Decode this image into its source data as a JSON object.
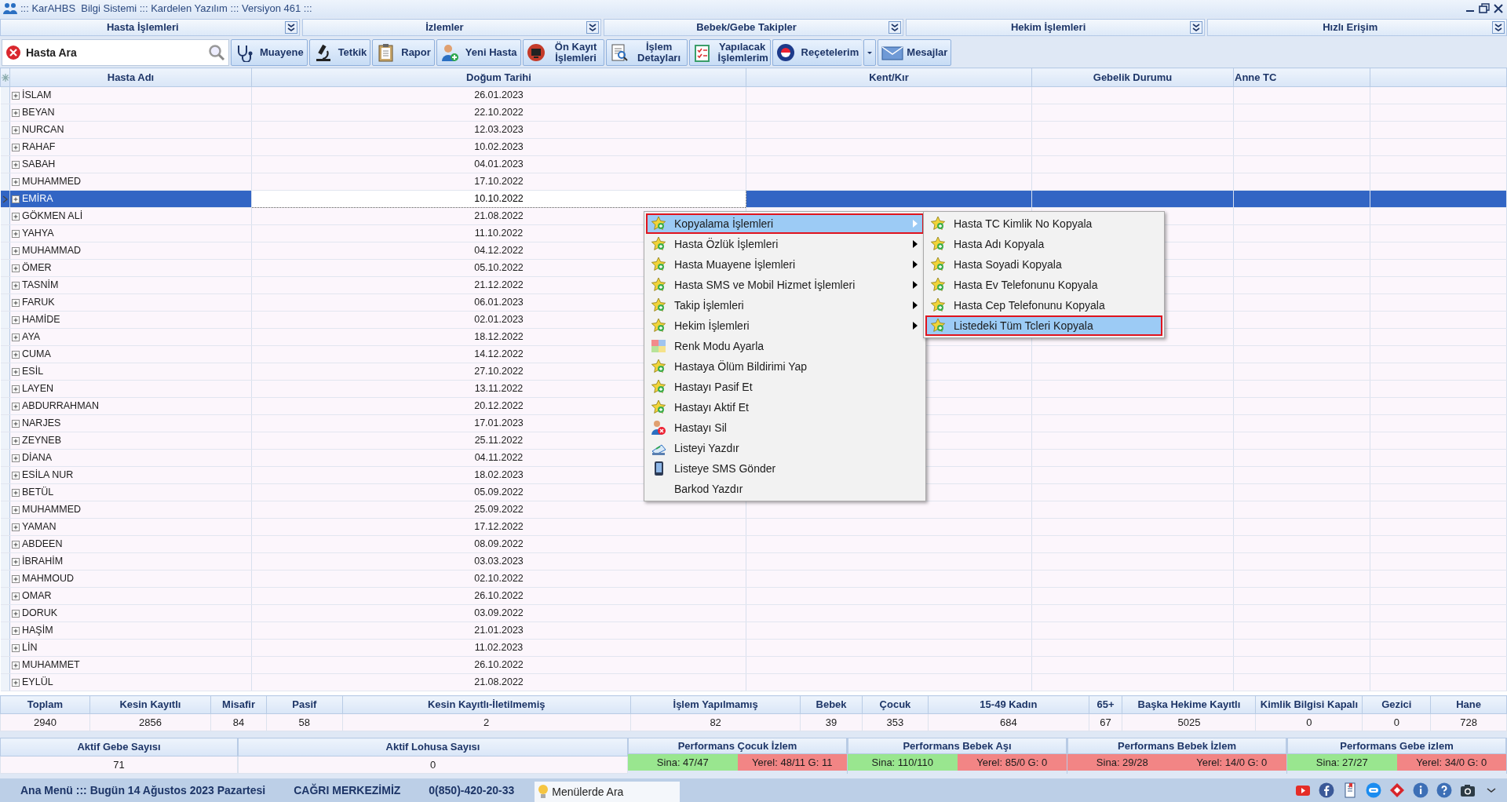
{
  "window": {
    "title": "::: KarAHBS  Bilgi Sistemi ::: Kardelen Yazılım ::: Versiyon 461 :::"
  },
  "sections": [
    {
      "label": "Hasta İşlemleri"
    },
    {
      "label": "İzlemler"
    },
    {
      "label": "Bebek/Gebe Takipler"
    },
    {
      "label": "Hekim İşlemleri"
    },
    {
      "label": "Hızlı Erişim"
    }
  ],
  "search": {
    "placeholder": "Hasta Ara"
  },
  "toolbar": [
    {
      "label": "Muayene",
      "kind": "stethoscope"
    },
    {
      "label": "Tetkik",
      "kind": "microscope"
    },
    {
      "label": "Rapor",
      "kind": "clipboard"
    },
    {
      "label": "Yeni Hasta",
      "kind": "user"
    },
    {
      "label": "Ön Kayıt İşlemleri",
      "kind": "monitor"
    },
    {
      "label": "İşlem Detayları",
      "kind": "document"
    },
    {
      "label": "Yapılacak İşlemlerim",
      "kind": "checklist"
    },
    {
      "label": "Reçetelerim",
      "kind": "capsule",
      "dropdown": true
    },
    {
      "label": "Mesajlar",
      "kind": "envelope"
    }
  ],
  "grid": {
    "columns": [
      "Hasta Adı",
      "Doğum Tarihi",
      "Kent/Kır",
      "Gebelik Durumu",
      "Anne TC"
    ],
    "rows": [
      {
        "name": "İSLAM",
        "date": "26.01.2023",
        "selected": false
      },
      {
        "name": "BEYAN",
        "date": "22.10.2022",
        "selected": false
      },
      {
        "name": "NURCAN",
        "date": "12.03.2023",
        "selected": false
      },
      {
        "name": "RAHAF",
        "date": "10.02.2023",
        "selected": false
      },
      {
        "name": "SABAH",
        "date": "04.01.2023",
        "selected": false
      },
      {
        "name": "MUHAMMED",
        "date": "17.10.2022",
        "selected": false
      },
      {
        "name": "EMİRA",
        "date": "10.10.2022",
        "selected": true
      },
      {
        "name": "GÖKMEN ALİ",
        "date": "21.08.2022",
        "selected": false
      },
      {
        "name": "YAHYA",
        "date": "11.10.2022",
        "selected": false
      },
      {
        "name": "MUHAMMAD",
        "date": "04.12.2022",
        "selected": false
      },
      {
        "name": "ÖMER",
        "date": "05.10.2022",
        "selected": false
      },
      {
        "name": "TASNİM",
        "date": "21.12.2022",
        "selected": false
      },
      {
        "name": "FARUK",
        "date": "06.01.2023",
        "selected": false
      },
      {
        "name": "HAMİDE",
        "date": "02.01.2023",
        "selected": false
      },
      {
        "name": "AYA",
        "date": "18.12.2022",
        "selected": false
      },
      {
        "name": "CUMA",
        "date": "14.12.2022",
        "selected": false
      },
      {
        "name": "ESİL",
        "date": "27.10.2022",
        "selected": false
      },
      {
        "name": "LAYEN",
        "date": "13.11.2022",
        "selected": false
      },
      {
        "name": "ABDURRAHMAN",
        "date": "20.12.2022",
        "selected": false
      },
      {
        "name": "NARJES",
        "date": "17.01.2023",
        "selected": false
      },
      {
        "name": "ZEYNEB",
        "date": "25.11.2022",
        "selected": false
      },
      {
        "name": "DİANA",
        "date": "04.11.2022",
        "selected": false
      },
      {
        "name": "ESİLA NUR",
        "date": "18.02.2023",
        "selected": false
      },
      {
        "name": "BETÜL",
        "date": "05.09.2022",
        "selected": false
      },
      {
        "name": "MUHAMMED",
        "date": "25.09.2022",
        "selected": false
      },
      {
        "name": "YAMAN",
        "date": "17.12.2022",
        "selected": false
      },
      {
        "name": "ABDEEN",
        "date": "08.09.2022",
        "selected": false
      },
      {
        "name": "İBRAHİM",
        "date": "03.03.2023",
        "selected": false
      },
      {
        "name": "MAHMOUD",
        "date": "02.10.2022",
        "selected": false
      },
      {
        "name": "OMAR",
        "date": "26.10.2022",
        "selected": false
      },
      {
        "name": "DORUK",
        "date": "03.09.2022",
        "selected": false
      },
      {
        "name": "HAŞİM",
        "date": "21.01.2023",
        "selected": false
      },
      {
        "name": "LİN",
        "date": "11.02.2023",
        "selected": false
      },
      {
        "name": "MUHAMMET",
        "date": "26.10.2022",
        "selected": false
      },
      {
        "name": "EYLÜL",
        "date": "21.08.2022",
        "selected": false
      }
    ]
  },
  "context_menu": {
    "items": [
      {
        "label": "Kopyalama İşlemleri",
        "kind": "star",
        "submenu": true,
        "selected": true
      },
      {
        "label": "Hasta Özlük İşlemleri",
        "kind": "star",
        "submenu": true,
        "selected": false
      },
      {
        "label": "Hasta Muayene İşlemleri",
        "kind": "star",
        "submenu": true,
        "selected": false
      },
      {
        "label": "Hasta SMS ve Mobil Hizmet İşlemleri",
        "kind": "star",
        "submenu": true,
        "selected": false
      },
      {
        "label": "Takip İşlemleri",
        "kind": "star",
        "submenu": true,
        "selected": false
      },
      {
        "label": "Hekim İşlemleri",
        "kind": "star",
        "submenu": true,
        "selected": false
      },
      {
        "label": "Renk Modu Ayarla",
        "kind": "palette",
        "submenu": false,
        "selected": false
      },
      {
        "label": "Hastaya Ölüm Bildirimi Yap",
        "kind": "star",
        "submenu": false,
        "selected": false
      },
      {
        "label": "Hastayı Pasif Et",
        "kind": "star",
        "submenu": false,
        "selected": false
      },
      {
        "label": "Hastayı Aktif Et",
        "kind": "star",
        "submenu": false,
        "selected": false
      },
      {
        "label": "Hastayı Sil",
        "kind": "user-remove",
        "submenu": false,
        "selected": false
      },
      {
        "label": "Listeyi Yazdır",
        "kind": "print",
        "submenu": false,
        "selected": false
      },
      {
        "label": "Listeye SMS Gönder",
        "kind": "phone",
        "submenu": false,
        "selected": false
      },
      {
        "label": "Barkod Yazdır",
        "kind": "none",
        "submenu": false,
        "selected": false
      }
    ]
  },
  "submenu": {
    "items": [
      {
        "label": "Hasta TC Kimlik No Kopyala",
        "kind": "star",
        "selected": false
      },
      {
        "label": "Hasta Adı Kopyala",
        "kind": "star",
        "selected": false
      },
      {
        "label": "Hasta Soyadi Kopyala",
        "kind": "star",
        "selected": false
      },
      {
        "label": "Hasta Ev Telefonunu Kopyala",
        "kind": "star",
        "selected": false
      },
      {
        "label": "Hasta Cep Telefonunu Kopyala",
        "kind": "star",
        "selected": false
      },
      {
        "label": "Listedeki Tüm Tcleri Kopyala",
        "kind": "star",
        "selected": true
      }
    ]
  },
  "stats": [
    {
      "label": "Toplam",
      "value": "2940"
    },
    {
      "label": "Kesin Kayıtlı",
      "value": "2856"
    },
    {
      "label": "Misafir",
      "value": "84"
    },
    {
      "label": "Pasif",
      "value": "58"
    },
    {
      "label": "Kesin Kayıtlı-İletilmemiş",
      "value": "2"
    },
    {
      "label": "İşlem Yapılmamış",
      "value": "82"
    },
    {
      "label": "Bebek",
      "value": "39"
    },
    {
      "label": "Çocuk",
      "value": "353"
    },
    {
      "label": "15-49 Kadın",
      "value": "684"
    },
    {
      "label": "65+",
      "value": "67"
    },
    {
      "label": "Başka Hekime Kayıtlı",
      "value": "5025"
    },
    {
      "label": "Kimlik Bilgisi Kapalı",
      "value": "0"
    },
    {
      "label": "Gezici",
      "value": "0"
    },
    {
      "label": "Hane",
      "value": "728"
    }
  ],
  "summary": [
    {
      "label": "Aktif Gebe Sayısı",
      "value": "71"
    },
    {
      "label": "Aktif Lohusa Sayısı",
      "value": "0"
    }
  ],
  "performance": [
    {
      "title": "Performans Çocuk İzlem",
      "cells": [
        {
          "text": "Sina: 47/47",
          "color": "#99e68f"
        },
        {
          "text": "Yerel: 48/11 G: 11",
          "color": "#f28585"
        }
      ]
    },
    {
      "title": "Performans Bebek Aşı",
      "cells": [
        {
          "text": "Sina: 110/110",
          "color": "#99e68f"
        },
        {
          "text": "Yerel: 85/0 G: 0",
          "color": "#f28585"
        }
      ]
    },
    {
      "title": "Performans Bebek İzlem",
      "cells": [
        {
          "text": "Sina: 29/28",
          "color": "#f28585"
        },
        {
          "text": "Yerel: 14/0 G: 0",
          "color": "#f28585"
        }
      ]
    },
    {
      "title": "Performans Gebe izlem",
      "cells": [
        {
          "text": "Sina: 27/27",
          "color": "#99e68f"
        },
        {
          "text": "Yerel: 34/0 G: 0",
          "color": "#f28585"
        }
      ]
    }
  ],
  "status_bar": {
    "texts": [
      "Ana Menü ::: Bugün 14 Ağustos 2023 Pazartesi",
      "CAĞRI MERKEZİMİZ",
      "0(850)-420-20-33"
    ],
    "search_tab": "Menülerde Ara"
  }
}
